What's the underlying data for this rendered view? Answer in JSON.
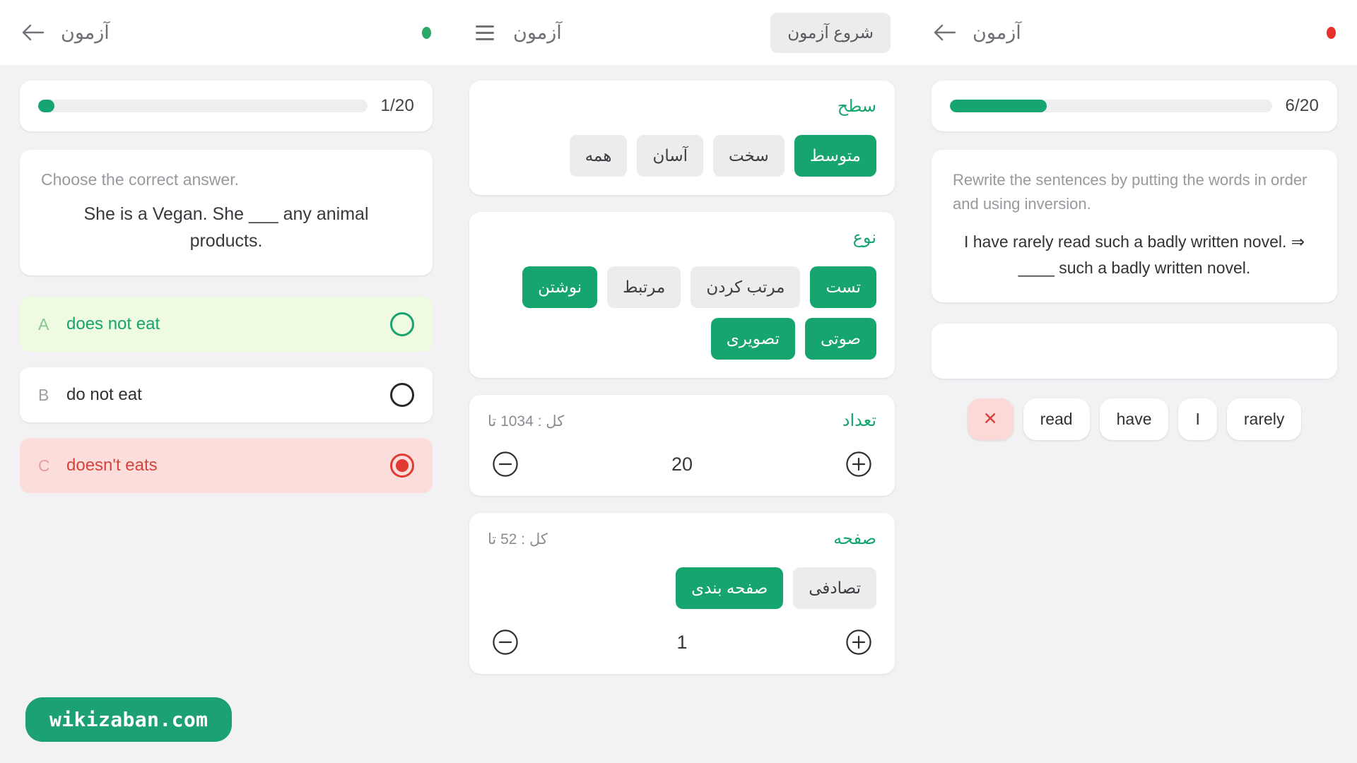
{
  "colors": {
    "accent_green": "#17a56f",
    "page_bg": "#f2f2f4",
    "card_bg": "#ffffff",
    "correct_bg": "#eefbe0",
    "wrong_bg": "#fbdedc",
    "chip_bg": "#ececec",
    "status_green": "#2aa866",
    "status_red": "#e8302a"
  },
  "left_panel": {
    "topbar": {
      "back_icon": "arrow-left-icon",
      "title": "آزمون",
      "status_dot": "green"
    },
    "progress": {
      "label": "1/20",
      "percent": 5
    },
    "question": {
      "instruction": "Choose the correct answer.",
      "sentence": "She is a Vegan. She ___ any animal products."
    },
    "options": [
      {
        "letter": "A",
        "text": "does not eat",
        "state": "correct"
      },
      {
        "letter": "B",
        "text": "do not eat",
        "state": "neutral"
      },
      {
        "letter": "C",
        "text": "doesn't eats",
        "state": "wrong"
      }
    ]
  },
  "mid_panel": {
    "topbar": {
      "menu_icon": "hamburger-icon",
      "title": "آزمون",
      "start_label": "شروع آزمون"
    },
    "level": {
      "title": "سطح",
      "options": [
        {
          "label": "سخت",
          "active": false
        },
        {
          "label": "متوسط",
          "active": true
        },
        {
          "label": "آسان",
          "active": false
        },
        {
          "label": "همه",
          "active": false
        }
      ]
    },
    "type": {
      "title": "نوع",
      "options": [
        {
          "label": "نوشتن",
          "active": true
        },
        {
          "label": "مرتبط",
          "active": false
        },
        {
          "label": "مرتب کردن",
          "active": false
        },
        {
          "label": "تست",
          "active": true
        },
        {
          "label": "تصویری",
          "active": true
        },
        {
          "label": "صوتی",
          "active": true
        }
      ]
    },
    "count": {
      "title": "تعداد",
      "total": "کل : 1034 تا",
      "value": "20",
      "minus_icon": "minus-circle-icon",
      "plus_icon": "plus-circle-icon"
    },
    "page": {
      "title": "صفحه",
      "total": "کل : 52 تا",
      "options": [
        {
          "label": "صفحه بندی",
          "active": true
        },
        {
          "label": "تصادفی",
          "active": false
        }
      ],
      "value": "1",
      "minus_icon": "minus-circle-icon",
      "plus_icon": "plus-circle-icon"
    }
  },
  "right_panel": {
    "topbar": {
      "back_icon": "arrow-left-icon",
      "title": "آزمون",
      "status_dot": "red"
    },
    "progress": {
      "label": "6/20",
      "percent": 30
    },
    "question": {
      "instruction": "Rewrite the sentences by putting the words in order and using inversion.",
      "sentence": "I have rarely read such a badly written novel. ⇒ ____ such a badly written novel."
    },
    "answer_slot_value": "",
    "word_bank": [
      {
        "label": "rarely",
        "type": "word"
      },
      {
        "label": "I",
        "type": "word"
      },
      {
        "label": "have",
        "type": "word"
      },
      {
        "label": "read",
        "type": "word"
      },
      {
        "label": "✕",
        "type": "clear"
      }
    ]
  },
  "watermark": {
    "text": "wikizaban.com"
  }
}
